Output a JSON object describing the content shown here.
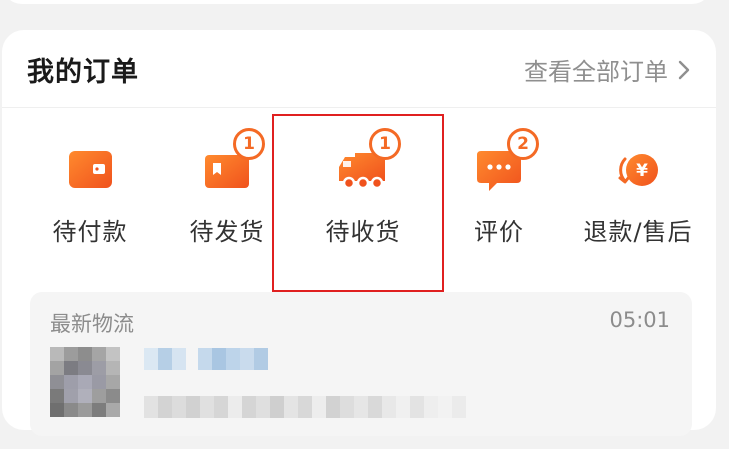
{
  "colors": {
    "accent": "#f46a25",
    "icon_gradient_start": "#ff8a2e",
    "icon_gradient_end": "#f0521d",
    "highlight_border": "#e02020"
  },
  "orders": {
    "title": "我的订单",
    "view_all": "查看全部订单",
    "view_all_icon": "chevron-right-icon",
    "statuses": [
      {
        "id": "pending-payment",
        "label": "待付款",
        "icon": "wallet-icon",
        "badge": ""
      },
      {
        "id": "pending-shipment",
        "label": "待发货",
        "icon": "gift-box-icon",
        "badge": "1"
      },
      {
        "id": "pending-receipt",
        "label": "待收货",
        "icon": "delivery-truck-icon",
        "badge": "1"
      },
      {
        "id": "review",
        "label": "评价",
        "icon": "chat-bubble-icon",
        "badge": "2"
      },
      {
        "id": "refund",
        "label": "退款/售后",
        "icon": "yuan-refund-icon",
        "badge": ""
      }
    ]
  },
  "logistics": {
    "title": "最新物流",
    "time": "05:01"
  }
}
